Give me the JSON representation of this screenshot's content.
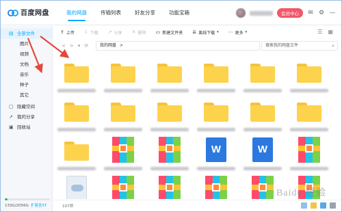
{
  "app": {
    "name": "百度网盘"
  },
  "nav": {
    "tabs": [
      "我的网盘",
      "传输列表",
      "好友分享",
      "功能宝箱"
    ],
    "active": 0
  },
  "header": {
    "vip_label": "会员中心"
  },
  "sidebar": {
    "main_items": [
      {
        "label": "全部文件",
        "icon": "file-list-icon",
        "active": true
      }
    ],
    "sub_items": [
      "图片",
      "视频",
      "文档",
      "音乐",
      "种子",
      "其它"
    ],
    "bottom_items": [
      {
        "label": "隐藏空间",
        "icon": "lock-icon"
      },
      {
        "label": "我的分享",
        "icon": "share-icon"
      },
      {
        "label": "回收站",
        "icon": "trash-icon"
      }
    ],
    "storage_text": "133G/2056G",
    "storage_fraction": 0.065,
    "expand_label": "扩容至5T"
  },
  "toolbar": {
    "buttons": [
      {
        "label": "上传",
        "icon": "upload-icon",
        "enabled": true
      },
      {
        "label": "下载",
        "icon": "download-icon",
        "enabled": false
      },
      {
        "label": "分享",
        "icon": "share-icon",
        "enabled": false
      },
      {
        "label": "删除",
        "icon": "delete-icon",
        "enabled": false
      },
      {
        "label": "新建文件夹",
        "icon": "new-folder-icon",
        "enabled": true
      },
      {
        "label": "离线下载",
        "icon": "offline-download-icon",
        "enabled": true
      },
      {
        "label": "更多",
        "icon": "more-icon",
        "enabled": true
      }
    ]
  },
  "path": {
    "back": "<",
    "forward": ">",
    "refresh": "⟳",
    "current": "我的网盘",
    "separator": ">"
  },
  "search": {
    "placeholder": "搜索我的网盘文件"
  },
  "files": {
    "rows": [
      [
        "folder",
        "folder",
        "folder",
        "folder",
        "folder",
        "folder"
      ],
      [
        "folder",
        "folder",
        "folder",
        "folder",
        "folder",
        "folder"
      ],
      [
        "folder",
        "archive",
        "archive",
        "word",
        "word",
        "archive"
      ],
      [
        "image",
        "archive",
        "archive",
        "archive",
        "archive",
        "archive"
      ]
    ],
    "word_letter": "W"
  },
  "footer": {
    "count": "107项"
  },
  "colors": {
    "accent": "#06a7ff",
    "folder": "#fdd24d",
    "word": "#2b79e0",
    "vip": "#f2576b",
    "annotation_arrow": "#e4473a"
  },
  "watermark": "Baidu 经验"
}
